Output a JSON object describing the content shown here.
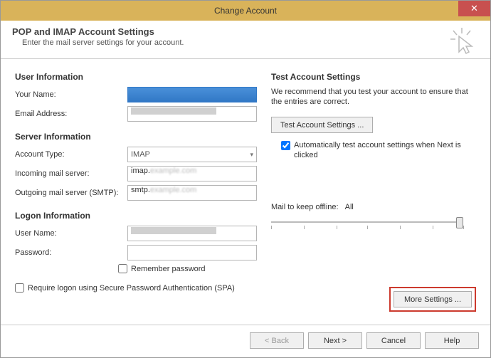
{
  "window": {
    "title": "Change Account"
  },
  "header": {
    "title": "POP and IMAP Account Settings",
    "subtitle": "Enter the mail server settings for your account."
  },
  "sections": {
    "user_info": "User Information",
    "server_info": "Server Information",
    "logon_info": "Logon Information"
  },
  "labels": {
    "your_name": "Your Name:",
    "email": "Email Address:",
    "account_type": "Account Type:",
    "incoming": "Incoming mail server:",
    "outgoing": "Outgoing mail server (SMTP):",
    "user_name": "User Name:",
    "password": "Password:",
    "remember": "Remember password",
    "spa": "Require logon using Secure Password Authentication (SPA)"
  },
  "values": {
    "account_type": "IMAP",
    "incoming": "imap.",
    "outgoing": "smtp."
  },
  "right": {
    "title": "Test Account Settings",
    "desc": "We recommend that you test your account to ensure that the entries are correct.",
    "test_btn": "Test Account Settings ...",
    "auto_test": "Automatically test account settings when Next is clicked",
    "mail_keep_label": "Mail to keep offline:",
    "mail_keep_value": "All",
    "more_settings": "More Settings ..."
  },
  "footer": {
    "back": "< Back",
    "next": "Next >",
    "cancel": "Cancel",
    "help": "Help"
  }
}
